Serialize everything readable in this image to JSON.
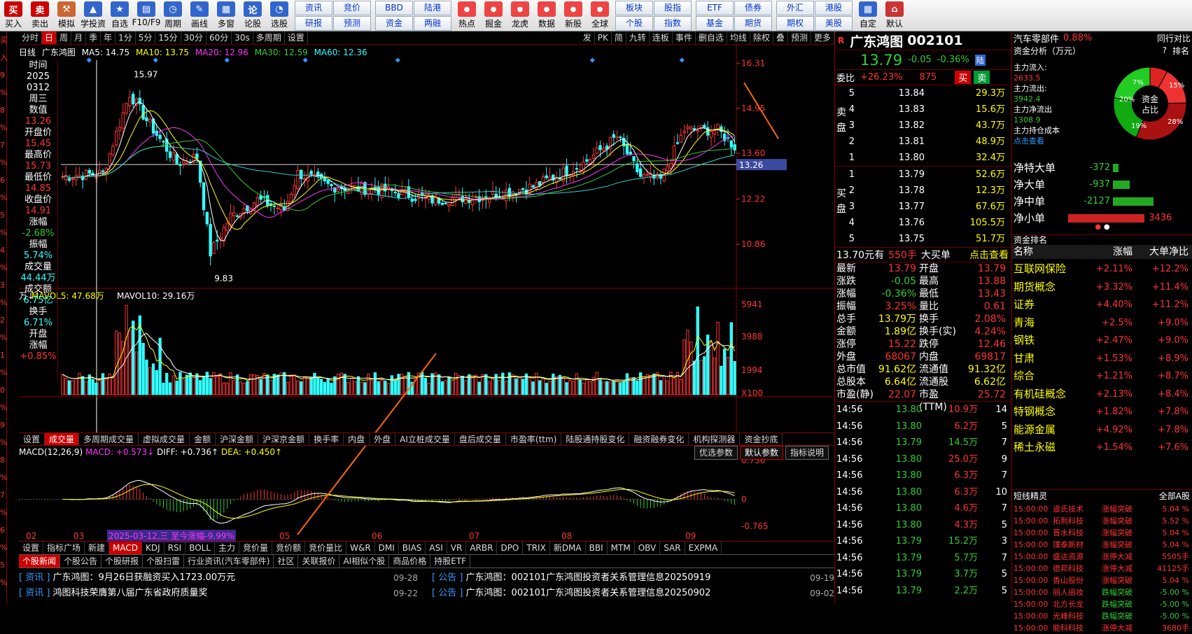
{
  "toolbar": {
    "items": [
      "买入",
      "卖出",
      "模拟",
      "学投资",
      "自选",
      "F10/F9",
      "周期",
      "画线",
      "多窗",
      "论股",
      "选股"
    ],
    "grid1": [
      "资讯",
      "竞价",
      "研报",
      "预测"
    ],
    "grid2": [
      "BBD",
      "陆港",
      "资金",
      "两融"
    ],
    "items2": [
      "热点",
      "掘金",
      "龙虎",
      "数据",
      "新股",
      "全球"
    ],
    "grid3": [
      "板块",
      "股指",
      "个股",
      "指数"
    ],
    "grid4": [
      "ETF",
      "债券",
      "基金",
      "期货"
    ],
    "grid5": [
      "外汇",
      "港股",
      "期权",
      "美股"
    ],
    "items3": [
      "自定",
      "默认"
    ]
  },
  "left_edge": [
    "买",
    "入",
    "9",
    "%",
    "8",
    "%",
    "7",
    "%",
    "6",
    "%",
    "5",
    "%",
    "4",
    "%",
    "3",
    "%",
    "2",
    "%",
    "1",
    "%",
    "0",
    "%",
    "9",
    "%",
    "8",
    "%",
    "7",
    "%",
    "6",
    "%",
    "5",
    "%",
    "4",
    "%",
    "3",
    "%",
    "2",
    "%",
    "1",
    "%",
    "5"
  ],
  "period": {
    "tabs": [
      "分时",
      "日",
      "周",
      "月",
      "季",
      "年",
      "1分",
      "5分",
      "15分",
      "30分",
      "60分",
      "30s",
      "多周期",
      "设置"
    ],
    "active": "日",
    "right": [
      "发",
      "PK",
      "简",
      "九转",
      "连板",
      "事件",
      "删自选",
      "均线",
      "除权",
      "叠",
      "预测",
      "更多"
    ]
  },
  "info": {
    "label": "日线",
    "name": "广东鸿图",
    "ma5": "MA5: 14.75",
    "ma10": "MA10: 13.75",
    "ma20": "MA20: 12.96",
    "ma30": "MA30: 12.59",
    "ma60": "MA60: 12.36"
  },
  "side": [
    {
      "l": "时间",
      "c": "wht"
    },
    {
      "l": "2025",
      "c": "wht"
    },
    {
      "l": "0312",
      "c": "wht"
    },
    {
      "l": "周三",
      "c": "wht"
    },
    {
      "l": "数值",
      "c": "wht"
    },
    {
      "l": "13.26",
      "c": "red"
    },
    {
      "l": "开盘价",
      "c": "wht"
    },
    {
      "l": "15.45",
      "c": "red"
    },
    {
      "l": "最高价",
      "c": "wht"
    },
    {
      "l": "15.73",
      "c": "red"
    },
    {
      "l": "最低价",
      "c": "wht"
    },
    {
      "l": "14.85",
      "c": "red"
    },
    {
      "l": "收盘价",
      "c": "wht"
    },
    {
      "l": "14.91",
      "c": "red"
    },
    {
      "l": "涨幅",
      "c": "wht"
    },
    {
      "l": "-2.68%",
      "c": "green"
    },
    {
      "l": "振幅",
      "c": "wht"
    },
    {
      "l": "5.74%",
      "c": "cyan"
    },
    {
      "l": "成交量",
      "c": "wht"
    },
    {
      "l": "44.44万",
      "c": "cyan"
    },
    {
      "l": "成交额",
      "c": "wht"
    },
    {
      "l": "6.75亿",
      "c": "cyan"
    },
    {
      "l": "换手",
      "c": "wht"
    },
    {
      "l": "6.71%",
      "c": "cyan"
    },
    {
      "l": "开盘",
      "c": "wht"
    },
    {
      "l": "涨幅",
      "c": "wht"
    },
    {
      "l": "+0.85%",
      "c": "red"
    }
  ],
  "price_axis": [
    "16.31",
    "14.95",
    "13.60",
    "12.22",
    "10.86"
  ],
  "current_price_tag": "13.26",
  "hi_label": "15.97",
  "lo_label": "9.83",
  "vol": {
    "label": "万↓",
    "mavol5": "MAVOL5: 47.68万",
    "mavol10": "MAVOL10: 29.16万",
    "axis": [
      "5941",
      "3988",
      "1994",
      "X100"
    ]
  },
  "ind_tabs": [
    "设置",
    "成交量",
    "多周期成交量",
    "虚拟成交量",
    "金额",
    "沪深金额",
    "沪深京金额",
    "换手率",
    "内盘",
    "外盘",
    "AI立桩成交量",
    "盘后成交量",
    "市盈率(ttm)",
    "陆股通持股变化",
    "融资融券变化",
    "机构探测器",
    "资金抄底"
  ],
  "macd": {
    "title": "MACD(12,26,9)",
    "macd": "MACD: +0.573↓",
    "diff": "DIFF: +0.736↑",
    "dea": "DEA: +0.450↑",
    "btns": [
      "优选参数",
      "默认参数",
      "指标说明"
    ],
    "axis": [
      "0.736",
      "0",
      "-0.765"
    ]
  },
  "time_axis": [
    "02",
    "03",
    "05",
    "06",
    "07",
    "08",
    "09"
  ],
  "range_label": "2025-03-12,三 至今涨幅-9.99%",
  "bot_tabs": [
    "设置",
    "指标广场",
    "新建",
    "MACD",
    "KDJ",
    "RSI",
    "BOLL",
    "主力",
    "竞价量",
    "竞价额",
    "竞价量比",
    "W&R",
    "DMI",
    "BIAS",
    "ASI",
    "VR",
    "ARBR",
    "DPO",
    "TRIX",
    "新DMA",
    "BBI",
    "MTM",
    "OBV",
    "SAR",
    "EXPMA"
  ],
  "news_tabs": [
    "个股新闻",
    "个股公告",
    "个股研报",
    "个股扫雷",
    "行业资讯(汽车零部件)",
    "社区",
    "关联报价",
    "AI相似个股",
    "商品价格",
    "持股ETF"
  ],
  "news": [
    {
      "tag": "资讯",
      "title": "广东鸿图：9月26日获融资买入1723.00万元",
      "date": "09-28"
    },
    {
      "tag": "资讯",
      "title": "鸿图科技荣膺第八届广东省政府质量奖",
      "date": "09-22"
    },
    {
      "tag": "公告",
      "title": "广东鸿图：002101广东鸿图投资者关系管理信息20250919",
      "date": "09-19"
    },
    {
      "tag": "公告",
      "title": "广东鸿图：002101广东鸿图投资者关系管理信息20250902",
      "date": "09-02"
    }
  ],
  "quote": {
    "name": "广东鸿图",
    "code": "002101",
    "price": "13.79",
    "chg": "-0.05",
    "pct": "-0.36%",
    "tag": "陆",
    "weibi_label": "委比",
    "weibi": "+26.23%",
    "weicha": "875",
    "buy": "买",
    "sell": "卖",
    "asks": [
      {
        "n": "5",
        "p": "13.84",
        "v": "29.3万"
      },
      {
        "n": "4",
        "p": "13.83",
        "v": "15.6万"
      },
      {
        "n": "3",
        "p": "13.82",
        "v": "43.7万"
      },
      {
        "n": "2",
        "p": "13.81",
        "v": "48.9万"
      },
      {
        "n": "1",
        "p": "13.80",
        "v": "32.4万"
      }
    ],
    "bids": [
      {
        "n": "1",
        "p": "13.79",
        "v": "52.6万"
      },
      {
        "n": "2",
        "p": "13.78",
        "v": "12.3万"
      },
      {
        "n": "3",
        "p": "13.77",
        "v": "67.6万"
      },
      {
        "n": "4",
        "p": "13.76",
        "v": "105.5万"
      },
      {
        "n": "5",
        "p": "13.75",
        "v": "51.7万"
      }
    ],
    "bigorder": {
      "a": "13.70元有",
      "b": "550手",
      "c": "大买单",
      "d": "点击查看"
    },
    "stats": [
      [
        "最新",
        "13.79",
        "开盘",
        "13.79"
      ],
      [
        "涨跌",
        "-0.05",
        "最高",
        "13.88"
      ],
      [
        "涨幅",
        "-0.36%",
        "最低",
        "13.43"
      ],
      [
        "振幅",
        "3.25%",
        "量比",
        "0.61"
      ],
      [
        "总手",
        "13.79万",
        "换手",
        "2.08%"
      ],
      [
        "金额",
        "1.89亿",
        "换手(实)",
        "4.24%"
      ],
      [
        "涨停",
        "15.22",
        "跌停",
        "12.46"
      ],
      [
        "外盘",
        "68067",
        "内盘",
        "69817"
      ],
      [
        "总市值",
        "91.62亿",
        "流通值",
        "91.32亿"
      ],
      [
        "总股本",
        "6.64亿",
        "流通股",
        "6.62亿"
      ],
      [
        "市盈(静)",
        "22.07",
        "市盈(TTM)",
        "25.72"
      ]
    ],
    "ticks": [
      [
        "14:56",
        "13.80",
        "10.9万",
        "14"
      ],
      [
        "14:56",
        "13.80",
        "6.2万",
        "5"
      ],
      [
        "14:56",
        "13.79",
        "14.5万",
        "7"
      ],
      [
        "14:56",
        "13.80",
        "25.0万",
        "9"
      ],
      [
        "14:56",
        "13.80",
        "6.3万",
        "7"
      ],
      [
        "14:56",
        "13.80",
        "6.3万",
        "10"
      ],
      [
        "14:56",
        "13.80",
        "4.6万",
        "7"
      ],
      [
        "14:56",
        "13.80",
        "4.3万",
        "5"
      ],
      [
        "14:56",
        "13.79",
        "15.2万",
        "3"
      ],
      [
        "14:56",
        "13.79",
        "5.7万",
        "7"
      ],
      [
        "14:56",
        "13.79",
        "3.7万",
        "5"
      ],
      [
        "14:56",
        "13.79",
        "2.2万",
        "5"
      ]
    ]
  },
  "fund": {
    "sector": "汽车零部件",
    "sector_pct": "0.88%",
    "rank_label": "同行对比",
    "analysis": "资金分析（万元）",
    "rank": "排名",
    "q": "?",
    "flows": [
      {
        "l": "主力流入:",
        "v": "2633.5"
      },
      {
        "l": "主力流出:",
        "v": "3942.4"
      },
      {
        "l": "主力净流出",
        "v": "1308.9"
      },
      {
        "l": "主力持仓成本",
        "v": ""
      }
    ],
    "click": "点击查看",
    "pie_center": "资金占比",
    "pie": [
      {
        "l": "7%",
        "c": "#d22"
      },
      {
        "l": "15%",
        "c": "#e33"
      },
      {
        "l": "28%",
        "c": "#a11"
      },
      {
        "l": "19%",
        "c": "#1a1"
      },
      {
        "l": "20%",
        "c": "#2c2"
      }
    ],
    "net": [
      {
        "l": "净特大单",
        "v": "-372",
        "c": "green",
        "w": 8
      },
      {
        "l": "净大单",
        "v": "-937",
        "c": "green",
        "w": 24
      },
      {
        "l": "净中单",
        "v": "-2127",
        "c": "green",
        "w": 58
      },
      {
        "l": "净小单",
        "v": "3436",
        "c": "red",
        "w": 95
      }
    ],
    "rank_title": "资金排名",
    "rank_head": [
      "名称",
      "涨幅",
      "大单净比"
    ],
    "ranks": [
      [
        "互联网保险",
        "+2.11%",
        "+12.2%"
      ],
      [
        "期货概念",
        "+3.32%",
        "+11.4%"
      ],
      [
        "证券",
        "+4.40%",
        "+11.2%"
      ],
      [
        "青海",
        "+2.5%",
        "+9.0%"
      ],
      [
        "钢铁",
        "+2.47%",
        "+9.0%"
      ],
      [
        "甘肃",
        "+1.53%",
        "+8.9%"
      ],
      [
        "综合",
        "+1.21%",
        "+8.7%"
      ],
      [
        "有机硅概念",
        "+2.13%",
        "+8.4%"
      ],
      [
        "特钢概念",
        "+1.82%",
        "+7.8%"
      ],
      [
        "能源金属",
        "+4.92%",
        "+7.8%"
      ],
      [
        "稀土永磁",
        "+1.54%",
        "+7.6%"
      ]
    ],
    "short_title": "短线精灵",
    "short_filter": "全部A股",
    "shorts": [
      [
        "15:00:00",
        "道氏技术",
        "涨幅突破",
        "5.04 %"
      ],
      [
        "15:00:00",
        "拓荆科技",
        "涨幅突破",
        "5.52 %"
      ],
      [
        "15:00:00",
        "晋水科技",
        "涨幅突破",
        "5.04 %"
      ],
      [
        "15:00:00",
        "璞泰新材",
        "涨幅突破",
        "5.04 %"
      ],
      [
        "15:00:00",
        "盛达资源",
        "涨停大减",
        "5505手"
      ],
      [
        "15:00:00",
        "德邦科技",
        "涨停大减",
        "41125手"
      ],
      [
        "15:00:00",
        "香山股份",
        "涨幅突破",
        "5.04 %"
      ],
      [
        "15:00:00",
        "丽人丽妆",
        "跌幅突破",
        "-5.00 %"
      ],
      [
        "15:00:00",
        "北方长龙",
        "跌幅突破",
        "-5.00 %"
      ],
      [
        "15:00:00",
        "光峰科技",
        "跌幅突破",
        "-5.00 %"
      ],
      [
        "15:00:00",
        "能科科技",
        "涨停大减",
        "3680手"
      ]
    ]
  },
  "chart_data": {
    "type": "candlestick",
    "x_range": [
      "2025-02",
      "2025-09"
    ],
    "y_range": [
      9.83,
      16.31
    ],
    "hi": 15.97,
    "lo": 9.83,
    "last": 13.79,
    "ma": {
      "MA5": 14.75,
      "MA10": 13.75,
      "MA20": 12.96,
      "MA30": 12.59,
      "MA60": 12.36
    }
  }
}
